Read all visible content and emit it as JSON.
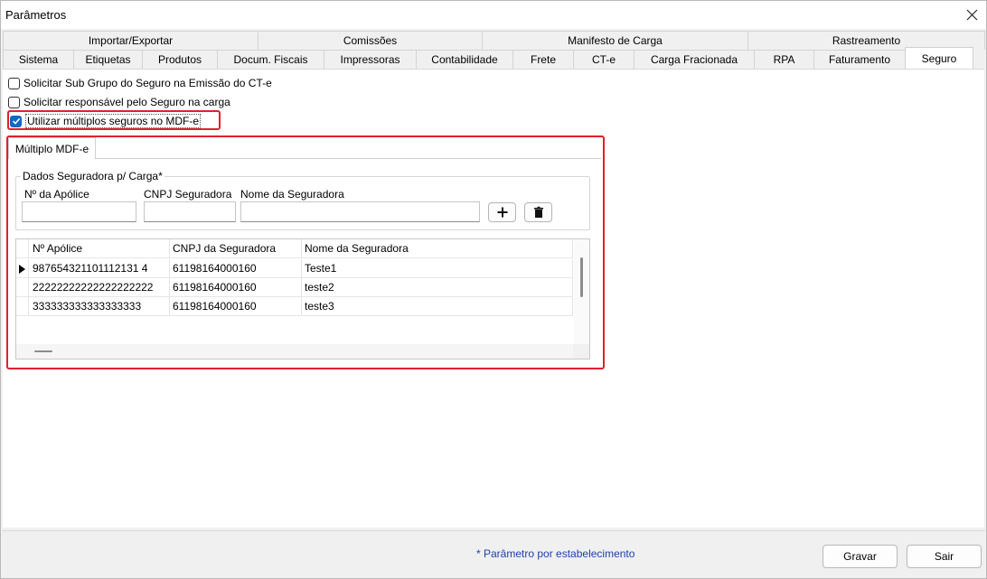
{
  "window": {
    "title": "Parâmetros"
  },
  "tabs_row1": [
    "Importar/Exportar",
    "Comissões",
    "Manifesto de Carga",
    "Rastreamento"
  ],
  "tabs_row2": [
    "Sistema",
    "Etiquetas",
    "Produtos",
    "Docum. Fiscais",
    "Impressoras",
    "Contabilidade",
    "Frete",
    "CT-e",
    "Carga Fracionada",
    "RPA",
    "Faturamento",
    "Seguro"
  ],
  "active_tab": "Seguro",
  "checkboxes": [
    {
      "label": "Solicitar Sub Grupo do Seguro na Emissão do CT-e",
      "checked": false
    },
    {
      "label": "Solicitar responsável pelo Seguro na carga",
      "checked": false
    },
    {
      "label": "Utilizar múltiplos seguros no MDF-e",
      "checked": true
    }
  ],
  "subtab": {
    "label": "Múltiplo MDF-e"
  },
  "group": {
    "title": "Dados Seguradora p/ Carga*",
    "fields": [
      {
        "label": "Nº da Apólice",
        "value": ""
      },
      {
        "label": "CNPJ Seguradora",
        "value": ""
      },
      {
        "label": "Nome da Seguradora",
        "value": ""
      }
    ],
    "add_icon": "plus-icon",
    "delete_icon": "trash-icon"
  },
  "grid": {
    "columns": [
      "Nº Apólice",
      "CNPJ da Seguradora",
      "Nome da Seguradora"
    ],
    "rows": [
      [
        "987654321101112131 4",
        "61198164000160",
        "Teste1"
      ],
      [
        "22222222222222222222",
        "61198164000160",
        "teste2"
      ],
      [
        "333333333333333333",
        "61198164000160",
        "teste3"
      ]
    ]
  },
  "footer": {
    "note": "* Parâmetro por estabelecimento",
    "save_label": "Gravar",
    "exit_label": "Sair"
  },
  "colors": {
    "highlight": "#e0202f",
    "accent": "#1266c4",
    "note": "#1f3fa8"
  }
}
